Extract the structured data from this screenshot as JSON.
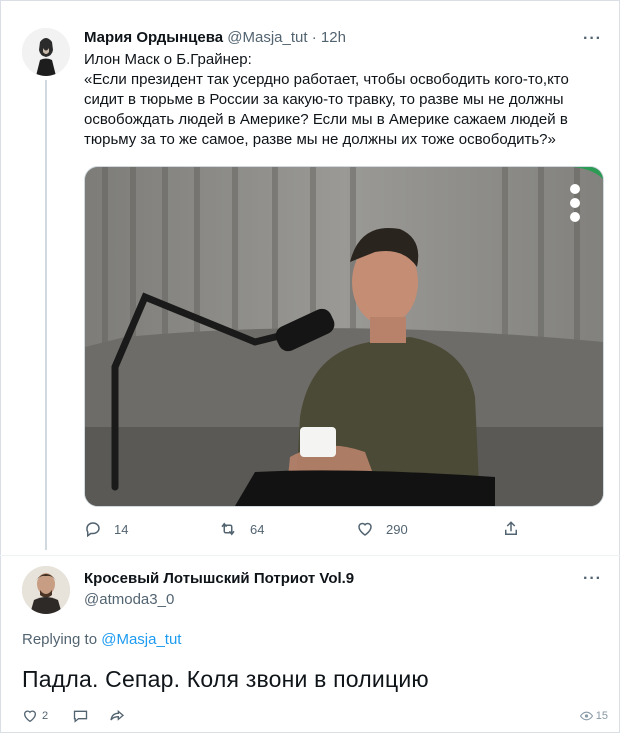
{
  "tweet": {
    "author_name": "Мария Ордынцева",
    "author_handle": "@Masja_tut",
    "separator": "·",
    "time": "12h",
    "text_lines": [
      "Илон Маск о Б.Грайнер:",
      "«Если президент так усердно работает, чтобы освободить кого-то,кто",
      "сидит в тюрьме в России за какую-то травку, то разве мы не должны",
      "освобождать людей в Америке? Если мы в Америке сажаем людей в",
      "тюрьму за то же самое, разве мы не должны их тоже освободить?»"
    ],
    "actions": {
      "replies": "14",
      "retweets": "64",
      "likes": "290"
    },
    "icons": [
      "reply-icon",
      "retweet-icon",
      "like-icon",
      "share-icon",
      "more-icon"
    ]
  },
  "reply": {
    "author_name": "Кросевый Лотышский Потриот Vol.9",
    "author_handle": "@atmoda3_0",
    "replying_prefix": "Replying to",
    "replying_to": "@Masja_tut",
    "text": "Падла. Сепар. Коля звони в полицию",
    "actions": {
      "likes": "2",
      "views": "15"
    },
    "icons": [
      "like-icon",
      "comment-icon",
      "share-icon",
      "views-icon",
      "more-icon"
    ]
  },
  "colors": {
    "text": "#0f1419",
    "secondary": "#536471",
    "accent": "#1d9bf0",
    "border": "#cfd9de"
  }
}
